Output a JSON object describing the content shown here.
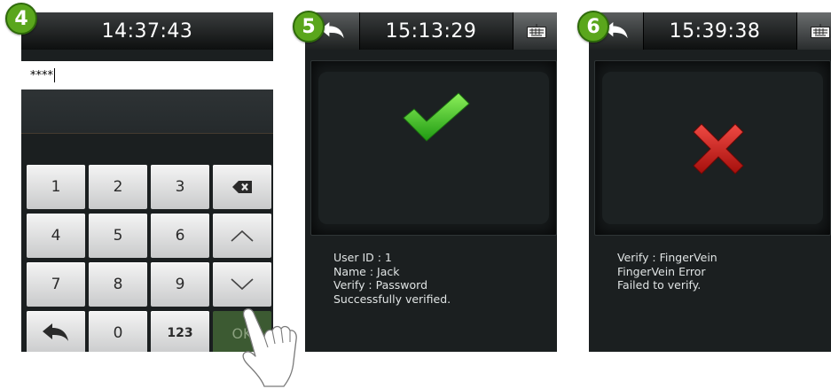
{
  "screens": [
    {
      "step": "4",
      "time": "14:37:43",
      "password_value": "****",
      "keypad": [
        "1",
        "2",
        "3",
        "backspace-icon",
        "4",
        "5",
        "6",
        "arrow-up-icon",
        "7",
        "8",
        "9",
        "arrow-down-icon",
        "back-arrow-icon",
        "0",
        "123",
        "OK"
      ]
    },
    {
      "step": "5",
      "time": "15:13:29",
      "result_icon": "checkmark-icon",
      "result_color": "#3cc21e",
      "lines": [
        "User ID : 1",
        "Name : Jack",
        "Verify : Password",
        "Successfully verified."
      ]
    },
    {
      "step": "6",
      "time": "15:39:38",
      "result_icon": "cross-icon",
      "result_color": "#d0201c",
      "lines": [
        "Verify : FingerVein",
        "FingerVein Error",
        "Failed to verify."
      ]
    }
  ],
  "colors": {
    "badge": "#5aa61c",
    "ok_key": "#3c5a32",
    "screen_bg": "#1b1f20"
  }
}
